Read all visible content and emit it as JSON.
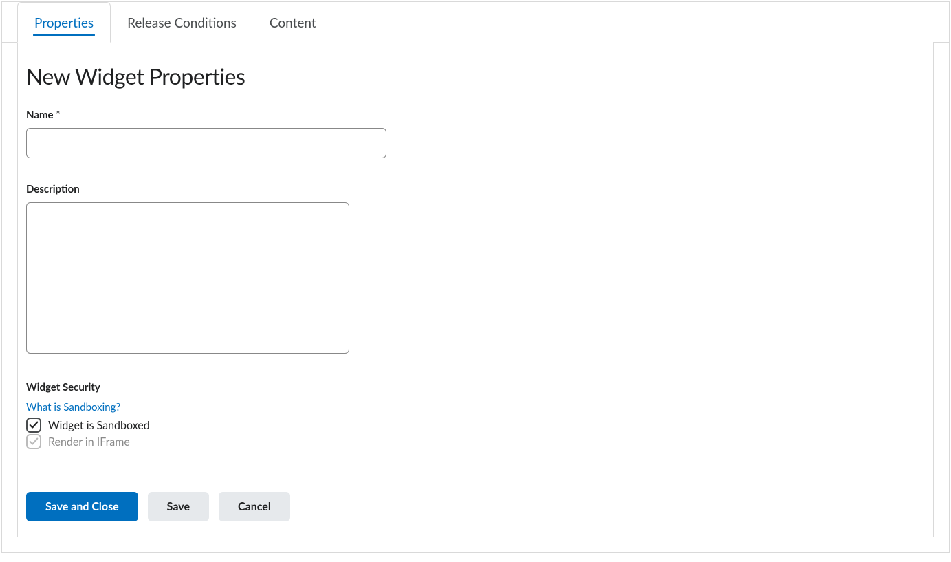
{
  "tabs": {
    "properties": "Properties",
    "release_conditions": "Release Conditions",
    "content": "Content"
  },
  "page": {
    "title": "New Widget Properties"
  },
  "fields": {
    "name_label": "Name",
    "required_marker": "*",
    "name_value": "",
    "description_label": "Description",
    "description_value": ""
  },
  "security": {
    "heading": "Widget Security",
    "help_link": "What is Sandboxing?",
    "sandboxed_label": "Widget is Sandboxed",
    "iframe_label": "Render in IFrame"
  },
  "buttons": {
    "save_close": "Save and Close",
    "save": "Save",
    "cancel": "Cancel"
  }
}
